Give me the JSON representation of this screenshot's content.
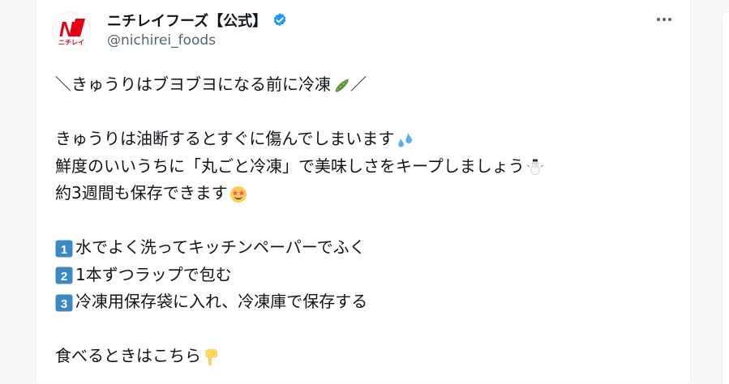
{
  "post": {
    "display_name": "ニチレイフーズ【公式】",
    "handle": "@nichirei_foods",
    "avatar_text": "ニチレイ",
    "avatar_letter": "N",
    "lines": [
      "＼きゅうりはブヨブヨになる前に冷凍",
      "／",
      "きゅうりは油断するとすぐに傷んでしまいます",
      "鮮度のいいうちに「丸ごと冷凍」で美味しさをキープしましょう",
      "約3週間も保存できます",
      "水でよく洗ってキッチンペーパーでふく",
      "1本ずつラップで包む",
      "冷凍用保存袋に入れ、冷凍庫で保存する",
      "食べるときはこちら"
    ],
    "steps": [
      "1",
      "2",
      "3"
    ]
  },
  "icons": {
    "verified": "verified-badge-icon",
    "more": "more-options-icon",
    "cucumber": "cucumber-emoji",
    "sweat": "sweat-droplets-emoji",
    "snowman": "snowman-emoji",
    "star_struck": "star-struck-emoji",
    "point_down": "backhand-index-pointing-down-emoji",
    "keycap": "keycap-number-icon"
  },
  "colors": {
    "brand_red": "#e60012",
    "verified_blue": "#1d9bf0",
    "text": "#0f1419",
    "secondary": "#536471",
    "keycap_blue": "#3b88c3"
  }
}
